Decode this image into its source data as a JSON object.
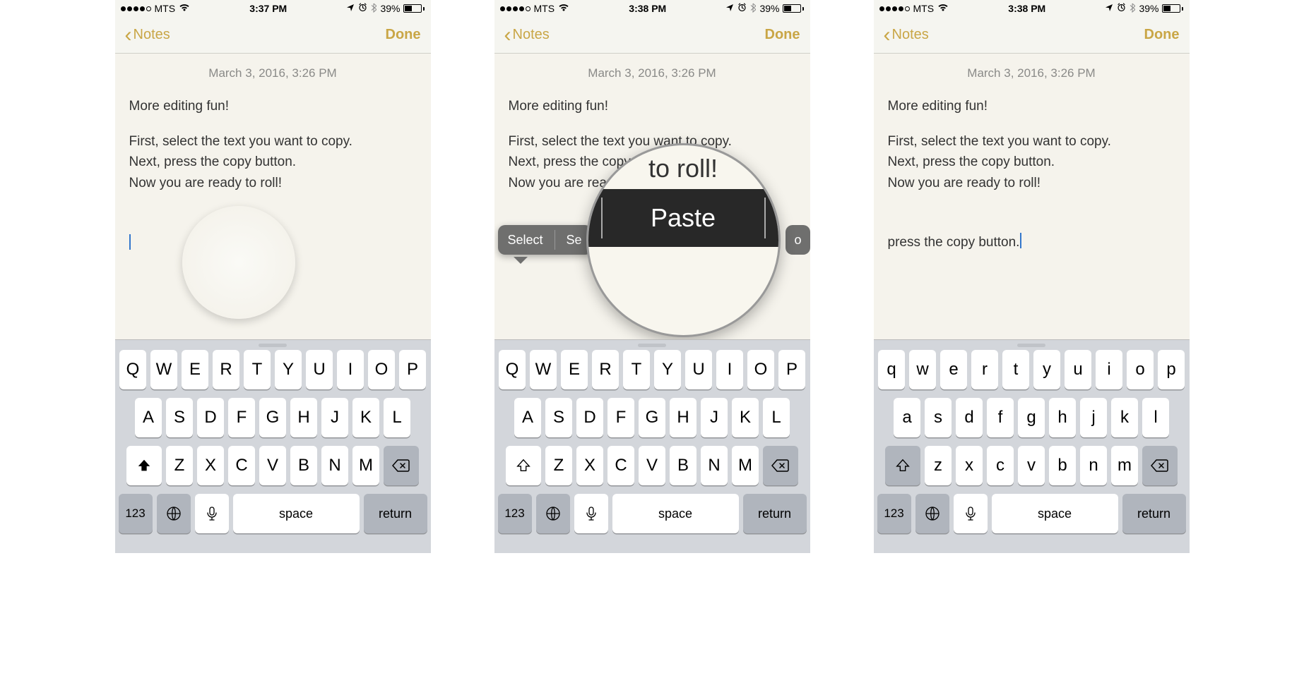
{
  "panels": [
    {
      "status": {
        "carrier": "MTS",
        "time": "3:37 PM",
        "battery": "39%"
      },
      "nav": {
        "back": "Notes",
        "done": "Done"
      },
      "date": "March 3, 2016, 3:26 PM",
      "title": "More editing fun!",
      "line1": "First, select the text you want to copy.",
      "line2": "Next, press the copy button.",
      "line3": "Now you are ready to roll!",
      "keyboard": {
        "shift_active": true,
        "space": "space",
        "return": "return",
        "numkey": "123"
      }
    },
    {
      "status": {
        "carrier": "MTS",
        "time": "3:38 PM",
        "battery": "39%"
      },
      "nav": {
        "back": "Notes",
        "done": "Done"
      },
      "date": "March 3, 2016, 3:26 PM",
      "title": "More editing fun!",
      "line1": "First, select the text you want to copy.",
      "line2": "Next, press the copy button.",
      "line3": "Now you are ready to roll!",
      "ctx": {
        "select": "Select",
        "selectall": "Se",
        "paste": "Paste",
        "mag_text": "to roll!"
      },
      "keyboard": {
        "shift_active": true,
        "space": "space",
        "return": "return",
        "numkey": "123"
      }
    },
    {
      "status": {
        "carrier": "MTS",
        "time": "3:38 PM",
        "battery": "39%"
      },
      "nav": {
        "back": "Notes",
        "done": "Done"
      },
      "date": "March 3, 2016, 3:26 PM",
      "title": "More editing fun!",
      "line1": "First, select the text you want to copy.",
      "line2": "Next, press the copy button.",
      "line3": "Now you are ready to roll!",
      "pasted": "press the copy button.",
      "keyboard": {
        "shift_active": false,
        "space": "space",
        "return": "return",
        "numkey": "123"
      }
    }
  ],
  "keys_upper_row1": [
    "Q",
    "W",
    "E",
    "R",
    "T",
    "Y",
    "U",
    "I",
    "O",
    "P"
  ],
  "keys_upper_row2": [
    "A",
    "S",
    "D",
    "F",
    "G",
    "H",
    "J",
    "K",
    "L"
  ],
  "keys_upper_row3": [
    "Z",
    "X",
    "C",
    "V",
    "B",
    "N",
    "M"
  ],
  "keys_lower_row1": [
    "q",
    "w",
    "e",
    "r",
    "t",
    "y",
    "u",
    "i",
    "o",
    "p"
  ],
  "keys_lower_row2": [
    "a",
    "s",
    "d",
    "f",
    "g",
    "h",
    "j",
    "k",
    "l"
  ],
  "keys_lower_row3": [
    "z",
    "x",
    "c",
    "v",
    "b",
    "n",
    "m"
  ]
}
